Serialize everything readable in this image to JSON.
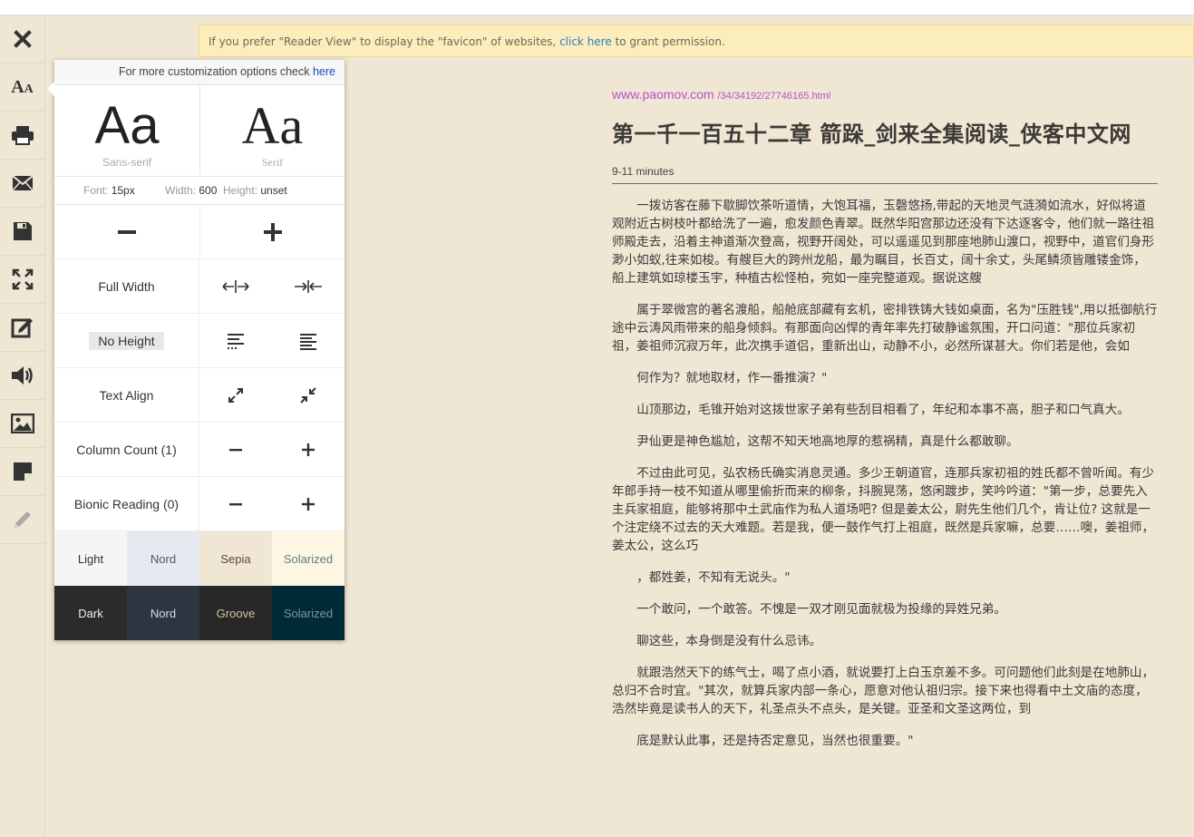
{
  "notice": {
    "before": "If you prefer \"Reader View\" to display the \"favicon\" of websites,",
    "link": "click here",
    "after": "to grant permission."
  },
  "toolbar": [
    {
      "name": "close-icon"
    },
    {
      "name": "font-settings-icon",
      "label": "AA"
    },
    {
      "name": "print-icon"
    },
    {
      "name": "email-icon"
    },
    {
      "name": "save-icon"
    },
    {
      "name": "fullscreen-icon"
    },
    {
      "name": "edit-icon"
    },
    {
      "name": "speaker-icon"
    },
    {
      "name": "image-icon"
    },
    {
      "name": "note-icon"
    },
    {
      "name": "pencil-icon"
    }
  ],
  "panel": {
    "custom_text": "For more customization options check",
    "custom_link": "here",
    "fonts": [
      {
        "sample": "Aa",
        "caption": "Sans-serif"
      },
      {
        "sample": "Aa",
        "caption": "Serif"
      }
    ],
    "metrics": {
      "font_label": "Font:",
      "font_value": "15px",
      "width_label": "Width:",
      "width_value": "600",
      "height_label": "Height:",
      "height_value": "unset"
    },
    "full_width": "Full Width",
    "no_height": "No Height",
    "text_align": "Text Align",
    "column_count": "Column Count (1)",
    "bionic_reading": "Bionic Reading (0)",
    "light_themes": [
      {
        "label": "Light",
        "bg": "#f5f5f5",
        "fg": "#333333"
      },
      {
        "label": "Nord",
        "bg": "#e5e9f0",
        "fg": "#4c566a"
      },
      {
        "label": "Sepia",
        "bg": "#f0e6d4",
        "fg": "#5b4636"
      },
      {
        "label": "Solarized",
        "bg": "#fdf6e3",
        "fg": "#657b83"
      }
    ],
    "dark_themes": [
      {
        "label": "Dark",
        "bg": "#2b2b2b",
        "fg": "#eeeeee"
      },
      {
        "label": "Nord",
        "bg": "#2e3440",
        "fg": "#d8dee9"
      },
      {
        "label": "Groove",
        "bg": "#282828",
        "fg": "#d5c4a1"
      },
      {
        "label": "Solarized",
        "bg": "#002b36",
        "fg": "#839496"
      }
    ]
  },
  "article": {
    "domain": "www.paomov.com",
    "path": "/34/34192/27746165.html",
    "title": "第一千一百五十二章 箭跺_剑来全集阅读_侠客中文网",
    "reading_time": "9-11 minutes",
    "paragraphs": [
      "一拨访客在藤下歇脚饮茶听道情，大饱耳福，玉磬悠扬,带起的天地灵气涟漪如流水，好似将道观附近古树枝叶都给洗了一遍，愈发颜色青翠。既然华阳宫那边还没有下达逐客令，他们就一路往祖师殿走去，沿着主神道渐次登高，视野开阔处，可以遥遥见到那座地肺山渡口，视野中，道官们身形渺小如蚁,往来如梭。有艘巨大的跨州龙船，最为瞩目，长百丈，阔十余丈，头尾鳞须皆雕镂金饰，船上建筑如琼楼玉宇，种植古松怪柏，宛如一座完整道观。据说这艘",
      "属于翠微宫的著名渡船，船舱底部藏有玄机，密排铁铸大钱如桌面，名为\"压胜钱\",用以抵御航行途中云涛风雨带来的船身倾斜。有那面向凶悍的青年率先打破静谧氛围，开口问道：\"那位兵家初祖，姜祖师沉寂万年，此次携手道侣，重新出山，动静不小，必然所谋甚大。你们若是他，会如",
      "何作为？就地取材，作一番推演？\"",
      "山顶那边，毛锥开始对这拨世家子弟有些刮目相看了，年纪和本事不高，胆子和口气真大。",
      "尹仙更是神色尴尬，这帮不知天地高地厚的惹祸精，真是什么都敢聊。",
      "不过由此可见，弘农杨氏确实消息灵通。多少王朝道官，连那兵家初祖的姓氏都不曾听闻。有少年郎手持一枝不知道从哪里偷折而来的柳条，抖腕晃荡，悠闲踱步，笑吟吟道：\"第一步，总要先入主兵家祖庭，能够将那中土武庙作为私人道场吧? 但是姜太公，尉先生他们几个，肯让位? 这就是一个注定绕不过去的天大难题。若是我，便一鼓作气打上祖庭，既然是兵家嘛，总要……噢，姜祖师，姜太公，这么巧",
      "，都姓姜，不知有无说头。\"",
      "一个敢问，一个敢答。不愧是一双才刚见面就极为投缘的异姓兄弟。",
      "聊这些，本身倒是没有什么忌讳。",
      "就跟浩然天下的练气士，喝了点小酒，就说要打上白玉京差不多。可问题他们此刻是在地肺山，总归不合时宜。\"其次，就算兵家内部一条心，愿意对他认祖归宗。接下来也得看中土文庙的态度，浩然毕竟是读书人的天下，礼圣点头不点头，是关键。亚圣和文圣这两位，到",
      "底是默认此事，还是持否定意见，当然也很重要。\""
    ]
  }
}
